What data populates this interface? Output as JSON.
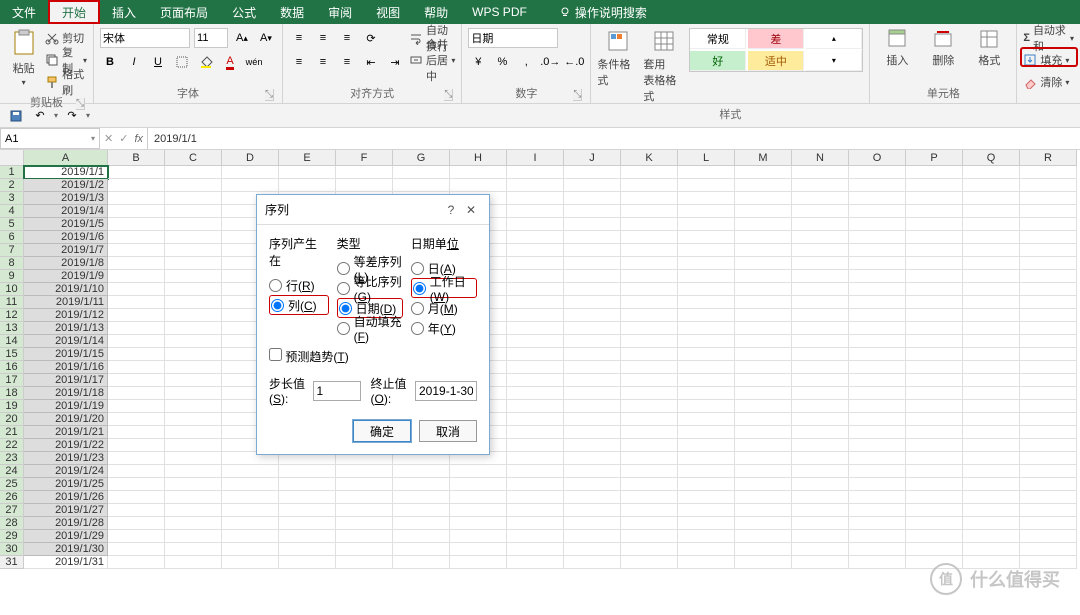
{
  "menu": {
    "tabs": [
      "文件",
      "开始",
      "插入",
      "页面布局",
      "公式",
      "数据",
      "审阅",
      "视图",
      "帮助",
      "WPS PDF"
    ],
    "selected_index": 1,
    "tell_me": "操作说明搜索"
  },
  "ribbon": {
    "clipboard": {
      "label": "剪贴板",
      "paste": "粘贴",
      "cut": "剪切",
      "copy": "复制",
      "format_painter": "格式刷"
    },
    "font": {
      "label": "字体",
      "name": "宋体",
      "size": "11",
      "bold": "B",
      "italic": "I",
      "underline": "U"
    },
    "alignment": {
      "label": "对齐方式",
      "wrap": "自动换行",
      "merge": "合并后居中"
    },
    "number": {
      "label": "数字",
      "format": "日期"
    },
    "styles": {
      "label": "样式",
      "cond": "条件格式",
      "table": "套用\n表格格式",
      "cells": [
        {
          "t": "常规",
          "bg": "#fff",
          "c": "#333"
        },
        {
          "t": "差",
          "bg": "#ffc7ce",
          "c": "#9c0006"
        },
        {
          "t": "好",
          "bg": "#c6efce",
          "c": "#006100"
        },
        {
          "t": "适中",
          "bg": "#ffeb9c",
          "c": "#9c5700"
        }
      ]
    },
    "cells_grp": {
      "label": "单元格",
      "insert": "插入",
      "delete": "删除",
      "format": "格式"
    },
    "editing": {
      "autosum": "自动求和",
      "fill": "填充",
      "clear": "清除"
    }
  },
  "namebox": {
    "ref": "A1",
    "formula": "2019/1/1"
  },
  "columns": [
    "A",
    "B",
    "C",
    "D",
    "E",
    "F",
    "G",
    "H",
    "I",
    "J",
    "K",
    "L",
    "M",
    "N",
    "O",
    "P",
    "Q",
    "R"
  ],
  "rows": [
    "1",
    "2",
    "3",
    "4",
    "5",
    "6",
    "7",
    "8",
    "9",
    "10",
    "11",
    "12",
    "13",
    "14",
    "15",
    "16",
    "17",
    "18",
    "19",
    "20",
    "21",
    "22",
    "23",
    "24",
    "25",
    "26",
    "27",
    "28",
    "29",
    "30",
    "31"
  ],
  "selected_rows": 30,
  "colA": [
    "2019/1/1",
    "2019/1/2",
    "2019/1/3",
    "2019/1/4",
    "2019/1/5",
    "2019/1/6",
    "2019/1/7",
    "2019/1/8",
    "2019/1/9",
    "2019/1/10",
    "2019/1/11",
    "2019/1/12",
    "2019/1/13",
    "2019/1/14",
    "2019/1/15",
    "2019/1/16",
    "2019/1/17",
    "2019/1/18",
    "2019/1/19",
    "2019/1/20",
    "2019/1/21",
    "2019/1/22",
    "2019/1/23",
    "2019/1/24",
    "2019/1/25",
    "2019/1/26",
    "2019/1/27",
    "2019/1/28",
    "2019/1/29",
    "2019/1/30",
    "2019/1/31"
  ],
  "dialog": {
    "title": "序列",
    "group1": {
      "hdr": "序列产生在",
      "rows": "行(R)",
      "cols": "列(C)"
    },
    "group2": {
      "hdr": "类型",
      "arith": "等差序列(L)",
      "geo": "等比序列(G)",
      "date": "日期(D)",
      "autofill": "自动填充(F)"
    },
    "group3": {
      "hdr": "日期单位",
      "day": "日(A)",
      "weekday": "工作日(W)",
      "month": "月(M)",
      "year": "年(Y)"
    },
    "trend": "预测趋势(T)",
    "step_label": "步长值(S):",
    "step": "1",
    "stop_label": "终止值(O):",
    "stop": "2019-1-30",
    "ok": "确定",
    "cancel": "取消"
  },
  "watermark": {
    "badge": "值",
    "text": "什么值得买"
  }
}
